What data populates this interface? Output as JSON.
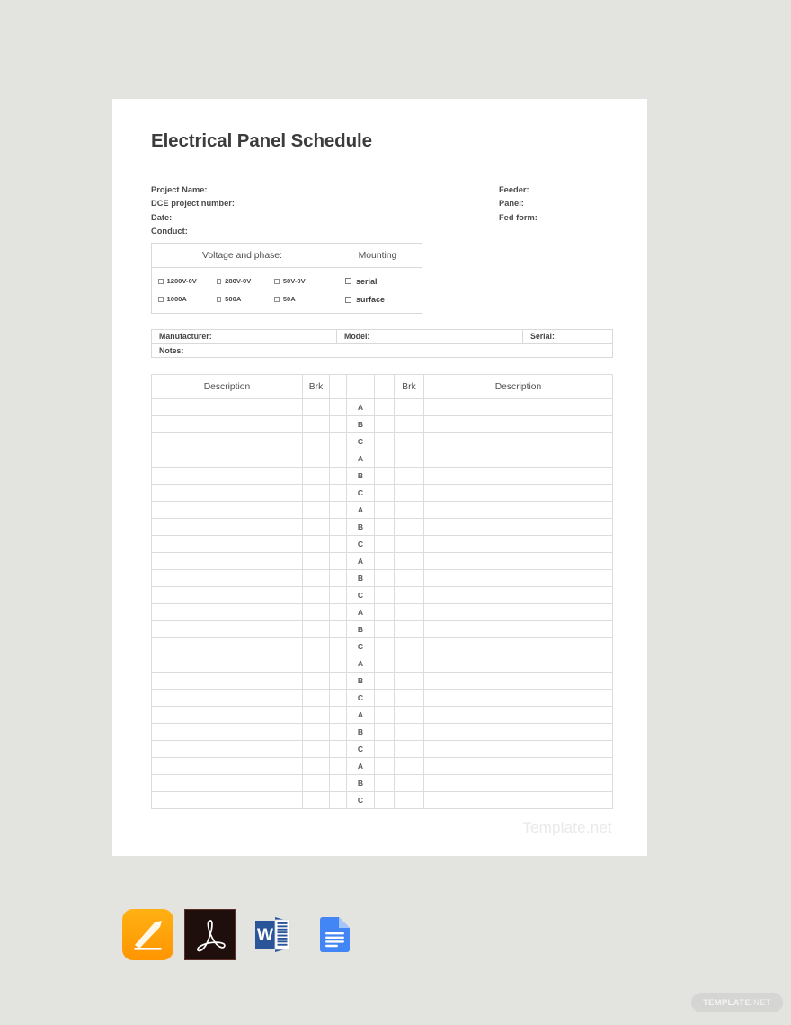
{
  "document": {
    "title_strong": "Electrical",
    "title_light": "Panel Schedule",
    "watermark": "Template.net"
  },
  "meta": {
    "left": [
      "Project Name:",
      "DCE project number:",
      "Date:",
      "Conduct:"
    ],
    "right": [
      "Feeder:",
      "Panel:",
      "Fed form:"
    ]
  },
  "voltage_table": {
    "voltage_header": "Voltage and phase:",
    "mounting_header": "Mounting",
    "voltage_options": [
      "1200V-0V",
      "280V-0V",
      "50V-0V",
      "1000A",
      "500A",
      "50A"
    ],
    "mounting_options": [
      "serial",
      "surface"
    ]
  },
  "manufacturer_table": {
    "manufacturer_label": "Manufacturer:",
    "model_label": "Model:",
    "serial_label": "Serial:",
    "notes_label": "Notes:"
  },
  "schedule_table": {
    "headers": [
      "Description",
      "Brk",
      "",
      "",
      "",
      "Brk",
      "Description"
    ],
    "phases": [
      "A",
      "B",
      "C",
      "A",
      "B",
      "C",
      "A",
      "B",
      "C",
      "A",
      "B",
      "C",
      "A",
      "B",
      "C",
      "A",
      "B",
      "C",
      "A",
      "B",
      "C",
      "A",
      "B",
      "C"
    ],
    "rows": [
      {
        "desc_left": "",
        "brk_left": "",
        "col3": "",
        "col5": "",
        "brk_right": "",
        "desc_right": ""
      },
      {
        "desc_left": "",
        "brk_left": "",
        "col3": "",
        "col5": "",
        "brk_right": "",
        "desc_right": ""
      },
      {
        "desc_left": "",
        "brk_left": "",
        "col3": "",
        "col5": "",
        "brk_right": "",
        "desc_right": ""
      },
      {
        "desc_left": "",
        "brk_left": "",
        "col3": "",
        "col5": "",
        "brk_right": "",
        "desc_right": ""
      },
      {
        "desc_left": "",
        "brk_left": "",
        "col3": "",
        "col5": "",
        "brk_right": "",
        "desc_right": ""
      },
      {
        "desc_left": "",
        "brk_left": "",
        "col3": "",
        "col5": "",
        "brk_right": "",
        "desc_right": ""
      },
      {
        "desc_left": "",
        "brk_left": "",
        "col3": "",
        "col5": "",
        "brk_right": "",
        "desc_right": ""
      },
      {
        "desc_left": "",
        "brk_left": "",
        "col3": "",
        "col5": "",
        "brk_right": "",
        "desc_right": ""
      },
      {
        "desc_left": "",
        "brk_left": "",
        "col3": "",
        "col5": "",
        "brk_right": "",
        "desc_right": ""
      },
      {
        "desc_left": "",
        "brk_left": "",
        "col3": "",
        "col5": "",
        "brk_right": "",
        "desc_right": ""
      },
      {
        "desc_left": "",
        "brk_left": "",
        "col3": "",
        "col5": "",
        "brk_right": "",
        "desc_right": ""
      },
      {
        "desc_left": "",
        "brk_left": "",
        "col3": "",
        "col5": "",
        "brk_right": "",
        "desc_right": ""
      },
      {
        "desc_left": "",
        "brk_left": "",
        "col3": "",
        "col5": "",
        "brk_right": "",
        "desc_right": ""
      },
      {
        "desc_left": "",
        "brk_left": "",
        "col3": "",
        "col5": "",
        "brk_right": "",
        "desc_right": ""
      },
      {
        "desc_left": "",
        "brk_left": "",
        "col3": "",
        "col5": "",
        "brk_right": "",
        "desc_right": ""
      },
      {
        "desc_left": "",
        "brk_left": "",
        "col3": "",
        "col5": "",
        "brk_right": "",
        "desc_right": ""
      },
      {
        "desc_left": "",
        "brk_left": "",
        "col3": "",
        "col5": "",
        "brk_right": "",
        "desc_right": ""
      },
      {
        "desc_left": "",
        "brk_left": "",
        "col3": "",
        "col5": "",
        "brk_right": "",
        "desc_right": ""
      },
      {
        "desc_left": "",
        "brk_left": "",
        "col3": "",
        "col5": "",
        "brk_right": "",
        "desc_right": ""
      },
      {
        "desc_left": "",
        "brk_left": "",
        "col3": "",
        "col5": "",
        "brk_right": "",
        "desc_right": ""
      },
      {
        "desc_left": "",
        "brk_left": "",
        "col3": "",
        "col5": "",
        "brk_right": "",
        "desc_right": ""
      },
      {
        "desc_left": "",
        "brk_left": "",
        "col3": "",
        "col5": "",
        "brk_right": "",
        "desc_right": ""
      },
      {
        "desc_left": "",
        "brk_left": "",
        "col3": "",
        "col5": "",
        "brk_right": "",
        "desc_right": ""
      },
      {
        "desc_left": "",
        "brk_left": "",
        "col3": "",
        "col5": "",
        "brk_right": "",
        "desc_right": ""
      }
    ]
  },
  "formats": [
    {
      "name": "apple-pages",
      "label": "Apple Pages"
    },
    {
      "name": "adobe-pdf",
      "label": "Adobe PDF"
    },
    {
      "name": "microsoft-word",
      "label": "Microsoft Word"
    },
    {
      "name": "google-docs",
      "label": "Google Docs"
    }
  ],
  "badge": {
    "strong": "TEMPLATE",
    "light": ".NET"
  },
  "colors": {
    "page_background": "#e3e3e0",
    "sheet": "#ffffff",
    "border": "#d9d9d9",
    "text": "#4a4a4a",
    "watermark": "#e9e9e9",
    "pages_orange": "#ff9500",
    "pdf_dark": "#1f0f0c",
    "word_blue": "#2a5699",
    "gdocs_blue": "#4285f4"
  }
}
